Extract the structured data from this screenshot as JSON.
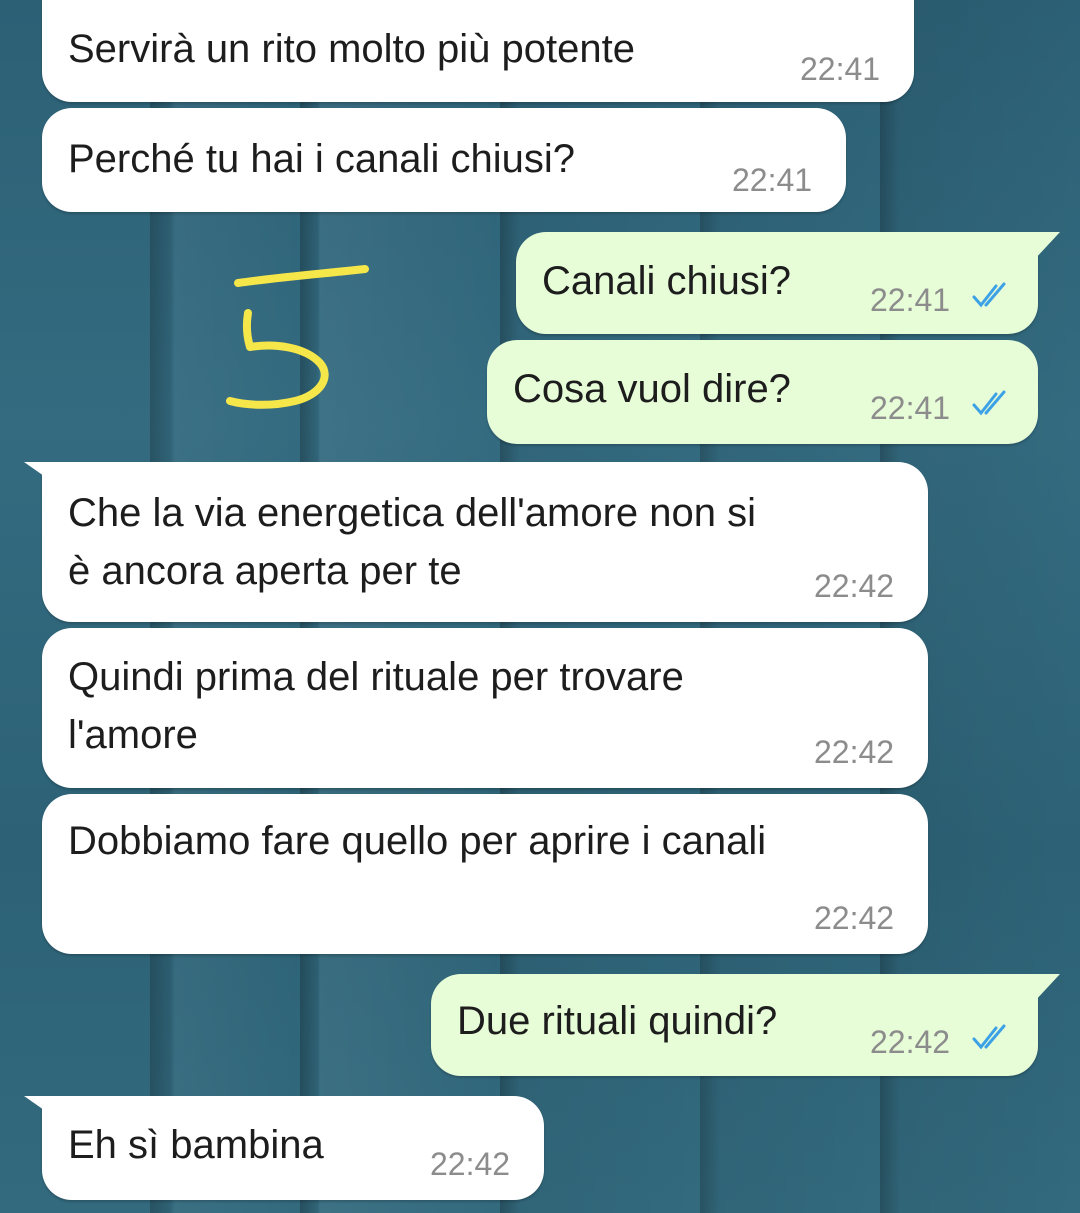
{
  "chat": {
    "messages": [
      {
        "dir": "in",
        "text": "Servirà un rito molto più potente",
        "time": "22:41"
      },
      {
        "dir": "in",
        "text": "Perché tu hai i canali chiusi?",
        "time": "22:41"
      },
      {
        "dir": "out",
        "text": "Canali chiusi?",
        "time": "22:41",
        "status": "read"
      },
      {
        "dir": "out",
        "text": "Cosa vuol dire?",
        "time": "22:41",
        "status": "read"
      },
      {
        "dir": "in",
        "text": "Che la via energetica dell'amore non si\nè ancora aperta per te",
        "time": "22:42"
      },
      {
        "dir": "in",
        "text": "Quindi prima del rituale per trovare\nl'amore",
        "time": "22:42"
      },
      {
        "dir": "in",
        "text": "Dobbiamo fare quello per aprire i canali",
        "time": "22:42"
      },
      {
        "dir": "out",
        "text": "Due rituali quindi?",
        "time": "22:42",
        "status": "read"
      },
      {
        "dir": "in",
        "text": "Eh sì bambina",
        "time": "22:42"
      }
    ]
  },
  "annotation": {
    "text": "5",
    "color": "#f5e64a"
  },
  "colors": {
    "incoming": "#ffffff",
    "outgoing": "#e7fdd8",
    "read_ticks": "#3da1e6"
  }
}
